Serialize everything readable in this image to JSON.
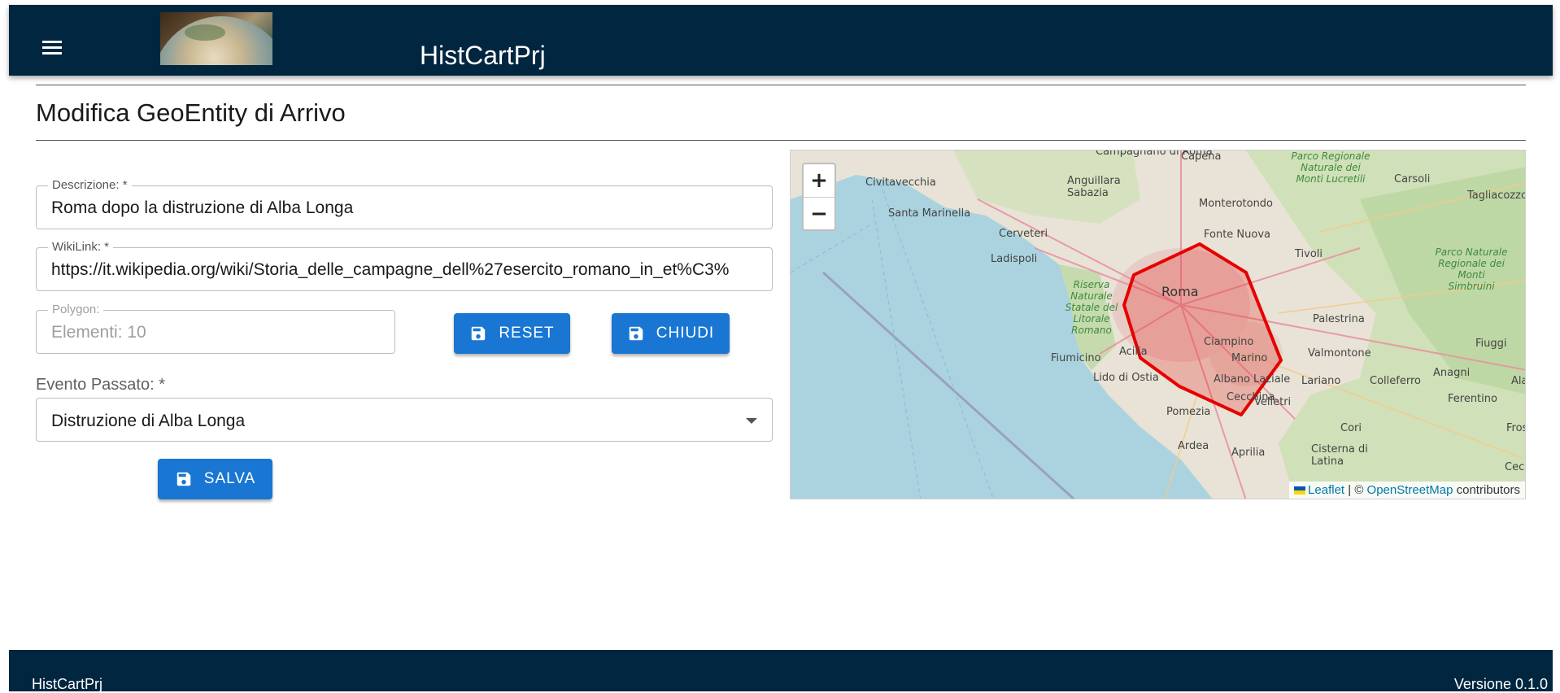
{
  "header": {
    "title": "HistCartPrj",
    "menu_icon": "menu-icon",
    "logo_icon": "globe-logo"
  },
  "page": {
    "title": "Modifica GeoEntity di Arrivo"
  },
  "form": {
    "descrizione": {
      "label": "Descrizione: *",
      "value": "Roma dopo la distruzione di Alba Longa"
    },
    "wikilink": {
      "label": "WikiLink: *",
      "value": "https://it.wikipedia.org/wiki/Storia_delle_campagne_dell%27esercito_romano_in_et%C3%"
    },
    "polygon": {
      "label": "Polygon:",
      "value": "Elementi: 10"
    },
    "evento": {
      "label": "Evento Passato: *",
      "value": "Distruzione di Alba Longa"
    },
    "buttons": {
      "reset": "RESET",
      "chiudi": "CHIUDI",
      "salva": "SALVA"
    }
  },
  "map": {
    "zoom_in": "+",
    "zoom_out": "−",
    "attribution": {
      "leaflet": "Leaflet",
      "separator": " | © ",
      "osm": "OpenStreetMap",
      "suffix": " contributors"
    },
    "places": {
      "campagnano": "Campagnano di Roma",
      "capena": "Capena",
      "civitavecchia": "Civitavecchia",
      "anguillara": "Anguillara Sabazia",
      "monterotondo": "Monterotondo",
      "fonte_nuova": "Fonte Nuova",
      "santa_marinella": "Santa Marinella",
      "cerveteri": "Cerveteri",
      "ladispoli": "Ladispoli",
      "tivoli": "Tivoli",
      "roma": "Roma",
      "riserva": "Riserva Naturale Statale del Litorale Romano",
      "palestrina": "Palestrina",
      "fiumicino": "Fiumicino",
      "acilia": "Acilia",
      "ciampino": "Ciampino",
      "marino": "Marino",
      "valmontone": "Valmontone",
      "lido": "Lido di Ostia",
      "albano": "Albano Laziale",
      "lariano": "Lariano",
      "colleferro": "Colleferro",
      "anagni": "Anagni",
      "cecchina": "Cecchina",
      "velletri": "Velletri",
      "pomezia": "Pomezia",
      "ardea": "Ardea",
      "aprilia": "Aprilia",
      "cori": "Cori",
      "cisterna": "Cisterna di Latina",
      "carsoli": "Carsoli",
      "tagliacozzo": "Tagliacozzo",
      "fiuggi": "Fiuggi",
      "ferentino": "Ferentino",
      "park_lucretili": "Parco Regionale Naturale dei Monti Lucretili",
      "park_simbruini": "Parco Naturale Regionale dei Monti Simbruini",
      "ala": "Ala",
      "fros": "Fros",
      "cecc": "Cecc"
    }
  },
  "footer": {
    "left": "HistCartPrj",
    "right": "Versione 0.1.0"
  },
  "colors": {
    "header_bg": "#002640",
    "button_bg": "#1976d2",
    "polygon_stroke": "#e60000"
  }
}
